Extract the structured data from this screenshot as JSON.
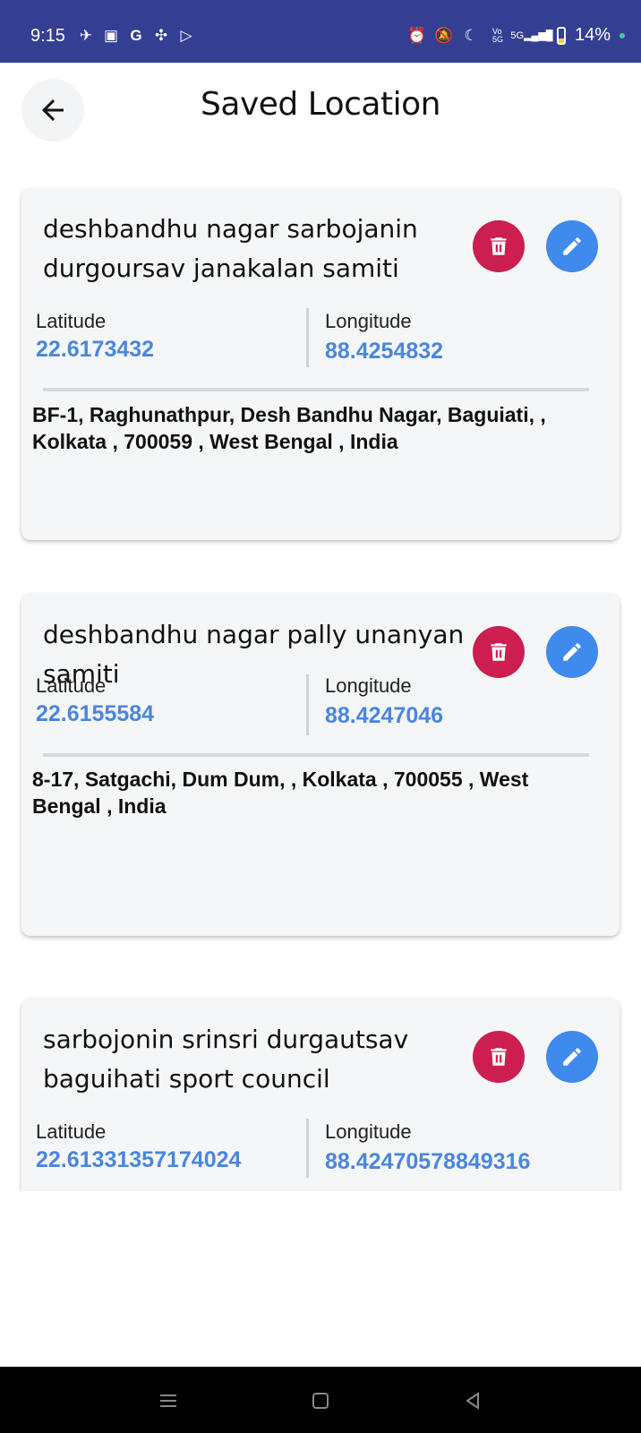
{
  "status_bar": {
    "time": "9:15",
    "battery": "14%",
    "left_icons": [
      "app-icon-1",
      "gallery-icon",
      "google-icon",
      "pinwheel-icon",
      "play-store-icon"
    ],
    "right_icons": [
      "alarm-icon",
      "mute-icon",
      "moon-icon",
      "volte-icon",
      "signal-5g-icon",
      "battery-icon"
    ],
    "network": "5G"
  },
  "header": {
    "title": "Saved Location"
  },
  "labels": {
    "latitude": "Latitude",
    "longitude": "Longitude"
  },
  "locations": [
    {
      "name": "deshbandhu nagar sarbojanin durgoursav janakalan samiti",
      "latitude": "22.6173432",
      "longitude": "88.4254832",
      "address": "BF-1, Raghunathpur, Desh Bandhu Nagar, Baguiati,  , Kolkata , 700059 , West Bengal , India"
    },
    {
      "name": "deshbandhu nagar pally unanyan samiti",
      "latitude": "22.6155584",
      "longitude": "88.4247046",
      "address": "8-17, Satgachi, Dum Dum,  , Kolkata , 700055 , West Bengal , India"
    },
    {
      "name": "sarbojonin srinsri durgautsav baguihati sport council",
      "latitude": "22.61331357174024",
      "longitude": "88.42470578849316",
      "address": ""
    }
  ],
  "colors": {
    "status_bar": "#343f93",
    "delete": "#cc1e4f",
    "edit": "#3f8aed",
    "coord_value": "#4a86df"
  }
}
